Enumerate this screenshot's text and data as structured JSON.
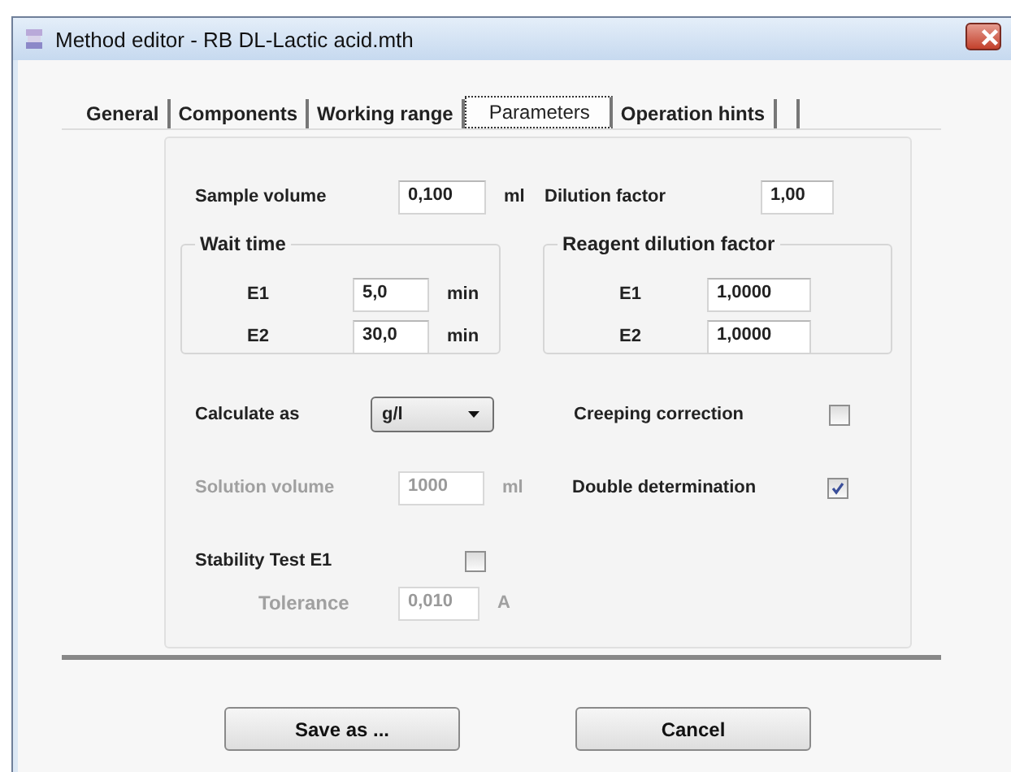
{
  "window": {
    "title": "Method editor - RB DL-Lactic acid.mth"
  },
  "tabs": [
    {
      "label": "General",
      "selected": false
    },
    {
      "label": "Components",
      "selected": false
    },
    {
      "label": "Working range",
      "selected": false
    },
    {
      "label": "Parameters",
      "selected": true
    },
    {
      "label": "Operation hints",
      "selected": false
    }
  ],
  "sample_volume": {
    "label": "Sample volume",
    "value": "0,100",
    "unit": "ml"
  },
  "dilution_factor": {
    "label": "Dilution factor",
    "value": "1,00"
  },
  "wait_time": {
    "title": "Wait time",
    "rows": [
      {
        "label": "E1",
        "value": "5,0",
        "unit": "min"
      },
      {
        "label": "E2",
        "value": "30,0",
        "unit": "min"
      }
    ]
  },
  "reagent_dilution_factor": {
    "title": "Reagent dilution factor",
    "rows": [
      {
        "label": "E1",
        "value": "1,0000"
      },
      {
        "label": "E2",
        "value": "1,0000"
      }
    ]
  },
  "calculate_as": {
    "label": "Calculate as",
    "value": "g/l"
  },
  "creeping_correction": {
    "label": "Creeping correction",
    "checked": false
  },
  "solution_volume": {
    "label": "Solution volume",
    "value": "1000",
    "unit": "ml",
    "disabled": true
  },
  "double_determination": {
    "label": "Double determination",
    "checked": true
  },
  "stability_test": {
    "label": "Stability Test E1",
    "checked": false
  },
  "tolerance": {
    "label": "Tolerance",
    "value": "0,010",
    "unit": "A",
    "disabled": true
  },
  "buttons": [
    "Save as ...",
    "Cancel"
  ]
}
